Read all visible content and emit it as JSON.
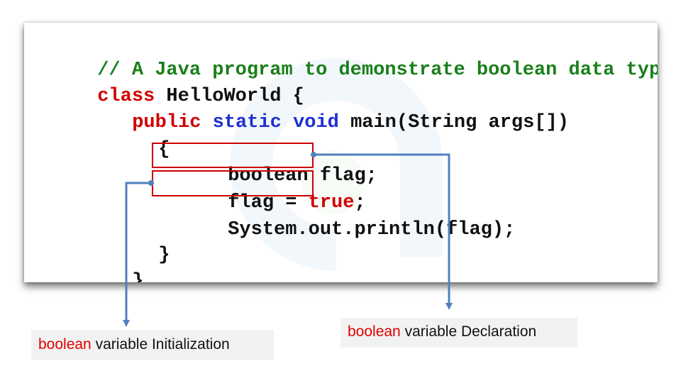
{
  "code": {
    "line1": {
      "comment": "// A Java program to demonstrate boolean data type"
    },
    "line2": {
      "keyword": "class",
      "rest": " HelloWorld {"
    },
    "line3": {
      "kw_public": "public",
      "kw_static": "static",
      "kw_void": "void",
      "rest": " main(String args[])"
    },
    "line4": {
      "text": "{"
    },
    "line5": {
      "text": "boolean flag;"
    },
    "line6": {
      "prefix": "flag = ",
      "kw_true": "true",
      "suffix": ";"
    },
    "line7": {
      "text": "System.out.println(flag);"
    },
    "line8": {
      "text": "}"
    },
    "line9": {
      "text": "}"
    }
  },
  "callouts": {
    "initialization": {
      "keyword": "boolean",
      "text": " variable Initialization"
    },
    "declaration": {
      "keyword": "boolean",
      "text": " variable Declaration"
    }
  },
  "colors": {
    "comment": "#1a7f1a",
    "keyword_red": "#d10000",
    "keyword_blue": "#1f2fd1",
    "highlight_box": "#cc0000",
    "connector": "#4f81bd",
    "callout_bg": "#f2f2f2"
  },
  "icons": {
    "watermark": "logo-watermark-icon"
  }
}
